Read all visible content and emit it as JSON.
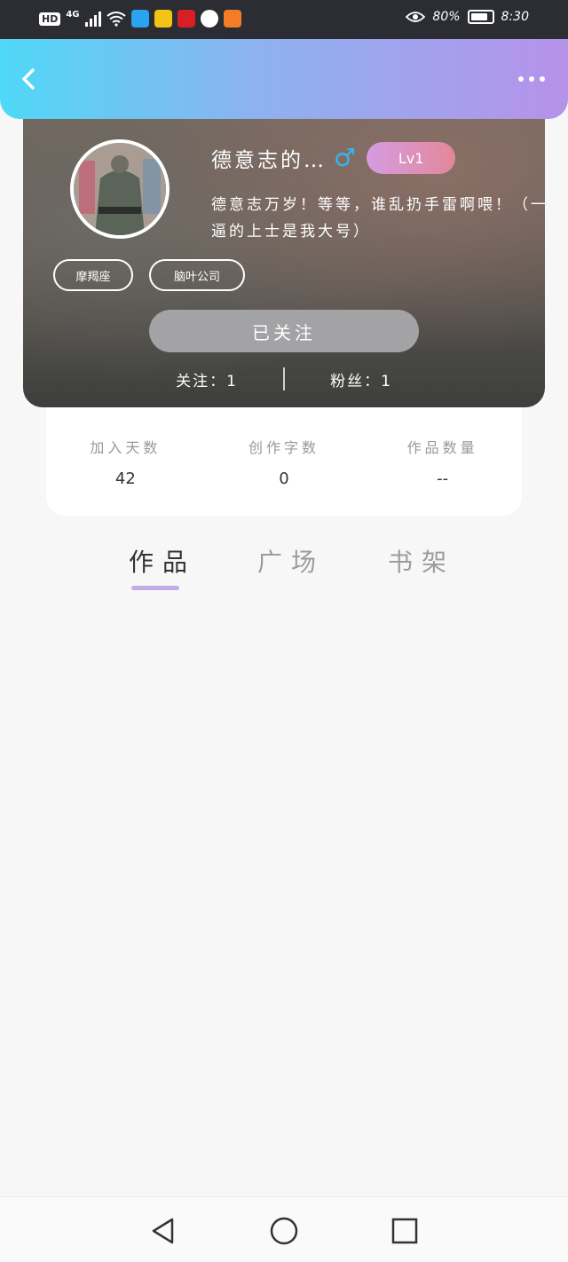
{
  "status_bar": {
    "network_badge": "HD",
    "network_type": "4G",
    "eye_battery_pct": "80%",
    "time": "8:30",
    "app_icon_colors": [
      "#2aa3f0",
      "#f1c515",
      "#d81f26",
      "#ffffff",
      "#f57c27"
    ]
  },
  "header": {
    "back_icon": "chevron-left-icon",
    "more_icon": "more-dots-icon",
    "gradient": [
      "#4fd8f7",
      "#8db2ef",
      "#b692ea"
    ]
  },
  "profile": {
    "nickname": "德意志的…",
    "gender_symbol": "♂",
    "level": "Lv1",
    "bio_line1": "德意志万岁！等等，谁乱扔手雷啊喂！（一",
    "bio_line2": "逼的上士是我大号）",
    "tags": [
      "摩羯座",
      "脑叶公司"
    ],
    "follow_button": "已关注",
    "following": "关注：1",
    "followers": "粉丝：1"
  },
  "stats": [
    {
      "label": "加入天数",
      "value": "42"
    },
    {
      "label": "创作字数",
      "value": "0"
    },
    {
      "label": "作品数量",
      "value": "--"
    }
  ],
  "tabs": [
    {
      "label": "作品",
      "active": true
    },
    {
      "label": "广场",
      "active": false
    },
    {
      "label": "书架",
      "active": false
    }
  ],
  "navbar": {
    "icons": [
      "triangle-back-icon",
      "circle-home-icon",
      "square-recent-icon"
    ]
  }
}
